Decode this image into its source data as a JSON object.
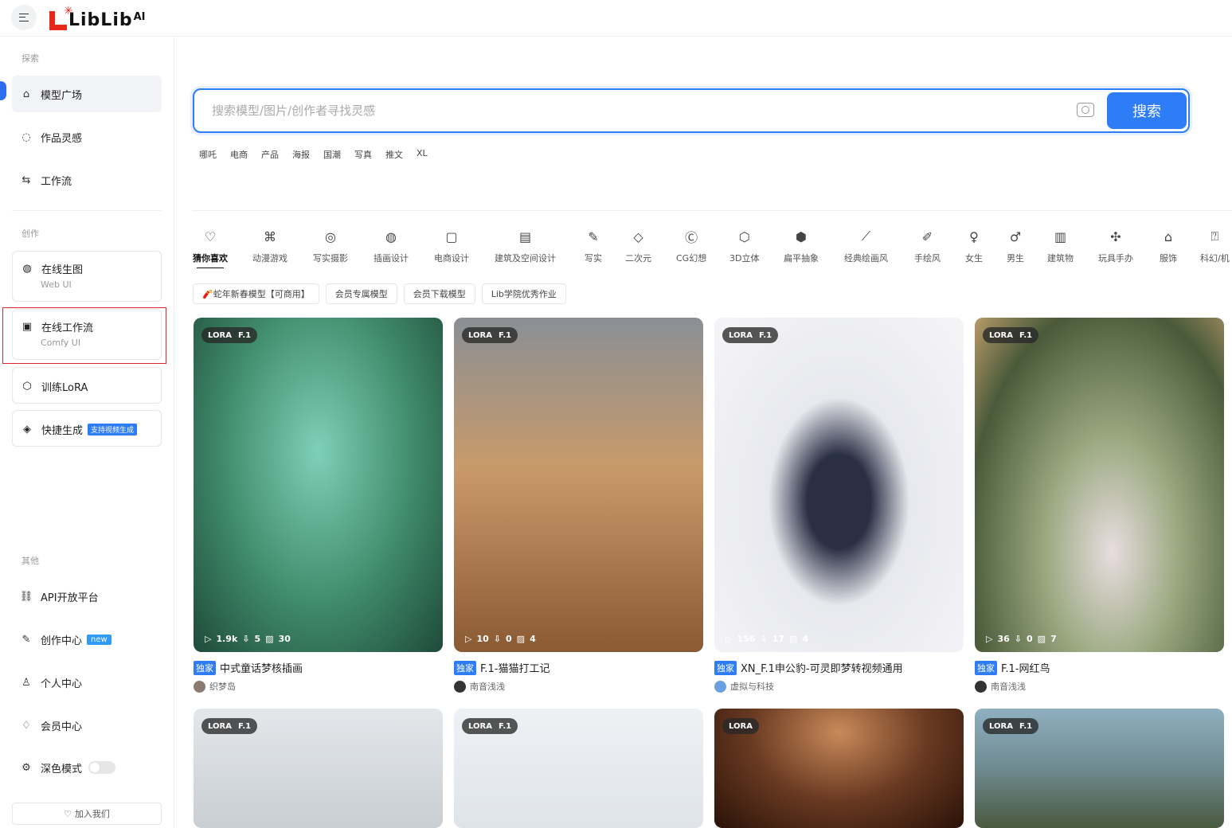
{
  "header": {
    "logo_text": "LibLib",
    "logo_ai": "AI"
  },
  "sidebar": {
    "sections": {
      "explore": "探索",
      "create": "创作",
      "other": "其他"
    },
    "explore_items": [
      {
        "label": "模型广场",
        "icon": "home-icon"
      },
      {
        "label": "作品灵感",
        "icon": "bulb-icon"
      },
      {
        "label": "工作流",
        "icon": "workflow-icon"
      }
    ],
    "create_items": [
      {
        "label": "在线生图",
        "sub": "Web UI",
        "icon": "palette-icon"
      },
      {
        "label": "在线工作流",
        "sub": "Comfy UI",
        "icon": "comfy-icon"
      },
      {
        "label": "训练LoRA",
        "icon": "cube-icon"
      },
      {
        "label": "快捷生成",
        "badge": "支持视频生成",
        "icon": "box-icon"
      }
    ],
    "other_items": [
      {
        "label": "API开放平台",
        "icon": "link-icon"
      },
      {
        "label": "创作中心",
        "badge": "new",
        "icon": "pen-icon"
      },
      {
        "label": "个人中心",
        "icon": "user-icon"
      },
      {
        "label": "会员中心",
        "icon": "diamond-icon"
      },
      {
        "label": "深色模式",
        "icon": "settings-icon"
      }
    ],
    "join_label": "加入我们"
  },
  "search": {
    "placeholder": "搜索模型/图片/创作者寻找灵感",
    "button": "搜索",
    "hot_tags": [
      "哪吒",
      "电商",
      "产品",
      "海报",
      "国潮",
      "写真",
      "推文",
      "XL"
    ]
  },
  "categories": [
    "猜你喜欢",
    "动漫游戏",
    "写实摄影",
    "插画设计",
    "电商设计",
    "建筑及空间设计",
    "写实",
    "二次元",
    "CG幻想",
    "3D立体",
    "扁平抽象",
    "经典绘画风",
    "手绘风",
    "女生",
    "男生",
    "建筑物",
    "玩具手办",
    "服饰",
    "科幻/机"
  ],
  "chips": [
    "🧨蛇年新春模型【可商用】",
    "会员专属模型",
    "会员下载模型",
    "Lib学院优秀作业"
  ],
  "cards": [
    {
      "tag": "LORA",
      "base": "F.1",
      "runs": "1.9k",
      "downloads": "5",
      "images": "30",
      "exclusive": "独家",
      "title": "中式童话梦核插画",
      "author": "织梦岛",
      "bg": "#3f8a6a"
    },
    {
      "tag": "LORA",
      "base": "F.1",
      "runs": "10",
      "downloads": "0",
      "images": "4",
      "exclusive": "独家",
      "title": "F.1-猫猫打工记",
      "author": "南音浅浅",
      "bg": "#b88a5a"
    },
    {
      "tag": "LORA",
      "base": "F.1",
      "runs": "156",
      "downloads": "17",
      "images": "4",
      "exclusive": "独家",
      "title": "XN_F.1申公豹-可灵即梦转视频通用",
      "author": "虚拟与科技",
      "bg": "#d9dbe3"
    },
    {
      "tag": "LORA",
      "base": "F.1",
      "runs": "36",
      "downloads": "0",
      "images": "7",
      "exclusive": "独家",
      "title": "F.1-网红鸟",
      "author": "南音浅浅",
      "bg": "#7c8a6a"
    },
    {
      "tag": "LORA",
      "base": "F.1",
      "bg": "#d7dde2"
    },
    {
      "tag": "LORA",
      "base": "F.1",
      "bg": "#e8ecf0"
    },
    {
      "tag": "LORA",
      "base": "",
      "bg": "#6a3a22"
    },
    {
      "tag": "LORA",
      "base": "F.1",
      "bg": "#6f8a90"
    }
  ]
}
